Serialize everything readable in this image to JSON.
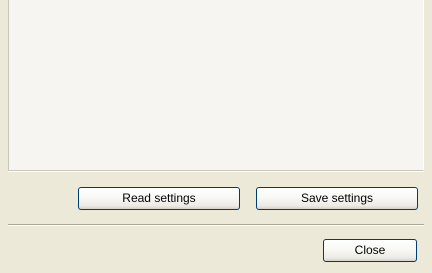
{
  "settings_panel": {
    "read_settings_label": "Read settings",
    "save_settings_label": "Save settings"
  },
  "footer": {
    "close_label": "Close"
  },
  "colors": {
    "window_background": "#ece9d8",
    "panel_background": "#f6f5f2",
    "button_border": "#003c74"
  }
}
